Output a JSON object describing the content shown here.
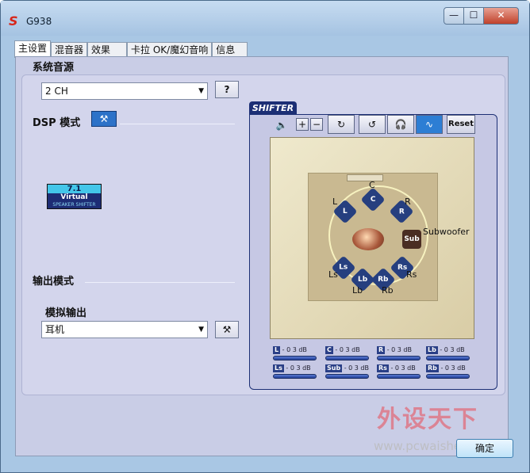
{
  "window": {
    "title": "G938",
    "app_icon": "S"
  },
  "tabs": [
    "主设置",
    "混音器",
    "效果",
    "卡拉 OK/魔幻音响",
    "信息"
  ],
  "main": {
    "source_label": "系统音源",
    "source_value": "2 CH",
    "help_label": "?",
    "dsp_label": "DSP 模式",
    "virtual_badge": {
      "top": "7.1",
      "mid": "Virtual",
      "bottom": "SPEAKER SHIFTER"
    },
    "output_mode_label": "输出模式",
    "analog_label": "模拟输出",
    "analog_value": "耳机"
  },
  "shifter": {
    "tab_label": "SHIFTER",
    "reset_label": "Reset",
    "speakers": {
      "C": "C",
      "L": "L",
      "R": "R",
      "Ls": "Ls",
      "Rs": "Rs",
      "Lb": "Lb",
      "Rb": "Rb",
      "Sub": "Sub",
      "Subwoofer": "Subwoofer"
    },
    "levels": [
      {
        "ch": "L",
        "val": "- 0 3 dB"
      },
      {
        "ch": "C",
        "val": "- 0 3 dB"
      },
      {
        "ch": "R",
        "val": "- 0 3 dB"
      },
      {
        "ch": "Lb",
        "val": "- 0 3 dB"
      },
      {
        "ch": "Ls",
        "val": "- 0 3 dB"
      },
      {
        "ch": "Sub",
        "val": "- 0 3 dB"
      },
      {
        "ch": "Rs",
        "val": "- 0 3 dB"
      },
      {
        "ch": "Rb",
        "val": "- 0 3 dB"
      }
    ]
  },
  "footer": {
    "ok_label": "确定"
  },
  "watermark": {
    "main": "外设天下",
    "url": "www.pcwaishe.cn"
  }
}
